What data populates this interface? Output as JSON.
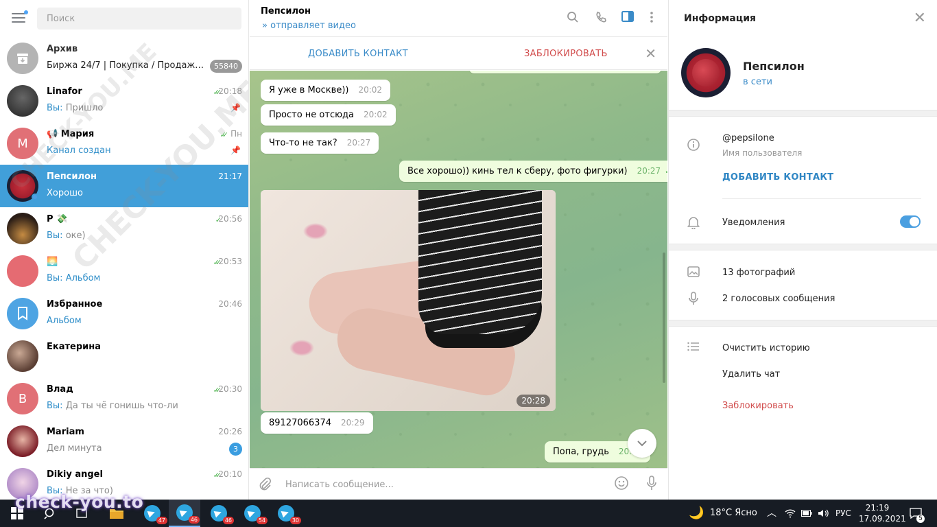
{
  "sidebar": {
    "search_placeholder": "Поиск",
    "chats": [
      {
        "name": "Архив",
        "preview": "Биржа 24/7 | Покупка / Продажа к...",
        "badge": "55840",
        "time": ""
      },
      {
        "name": "Linafor",
        "time": "20:18",
        "you": "Вы:",
        "preview": "Пришло"
      },
      {
        "name": "📢 Мария",
        "time": "Пн",
        "preview": "Канал создан",
        "avatar_letter": "М"
      },
      {
        "name": "Пепсилон",
        "time": "21:17",
        "preview": "Хорошо"
      },
      {
        "name": "Р 💸",
        "time": "20:56",
        "you": "Вы:",
        "preview": "оке)"
      },
      {
        "name": "🌅",
        "time": "20:53",
        "you": "Вы:",
        "preview": "Альбом"
      },
      {
        "name": "Избранное",
        "time": "20:46",
        "preview": "Альбом"
      },
      {
        "name": "Екатерина",
        "time": "",
        "preview": ""
      },
      {
        "name": "Влад",
        "time": "20:30",
        "you": "Вы:",
        "preview": "Да ты чё гонишь что-ли",
        "avatar_letter": "В"
      },
      {
        "name": "Mariam",
        "time": "20:26",
        "preview": "Дел минута",
        "badge": "3"
      },
      {
        "name": "Dikiy angel",
        "time": "20:10",
        "you": "Вы:",
        "preview": "Не за что)"
      }
    ],
    "watermark": "CHECK-YOU.ME"
  },
  "chat": {
    "title": "Пепсилон",
    "status": "отправляет видео",
    "add_contact": "ДОБАВИТЬ КОНТАКТ",
    "block": "ЗАБЛОКИРОВАТЬ",
    "messages": [
      {
        "text": "Я уже в Москве))",
        "time": "20:02"
      },
      {
        "text": "Просто не отсюда",
        "time": "20:02"
      },
      {
        "text": "Что-то не так?",
        "time": "20:27"
      },
      {
        "text": "Все хорошо)) кинь тел к сберу, фото фигурки)",
        "time": "20:27"
      },
      {
        "text": "89127066374",
        "time": "20:29"
      },
      {
        "text": "Попа, грудь",
        "time": "20:37"
      }
    ],
    "photo_time": "20:28",
    "composer_placeholder": "Написать сообщение..."
  },
  "info": {
    "header": "Информация",
    "name": "Пепсилон",
    "status": "в сети",
    "username": "@pepsilone",
    "username_label": "Имя пользователя",
    "add_contact": "ДОБАВИТЬ КОНТАКТ",
    "notifications": "Уведомления",
    "notifications_on": true,
    "photos": "13 фотографий",
    "voice": "2 голосовых сообщения",
    "clear_history": "Очистить историю",
    "delete_chat": "Удалить чат",
    "block": "Заблокировать"
  },
  "taskbar": {
    "tg_counts": [
      "47",
      "46",
      "46",
      "54",
      "30"
    ],
    "weather": "18°C  Ясно",
    "lang": "РУС",
    "time": "21:19",
    "date": "17.09.2021",
    "notif_count": "5",
    "watermark": "check-you.to"
  },
  "colors": {
    "accent": "#419fd9",
    "link": "#3a8bc8",
    "danger": "#d14c4c",
    "tick": "#4cb24d"
  }
}
